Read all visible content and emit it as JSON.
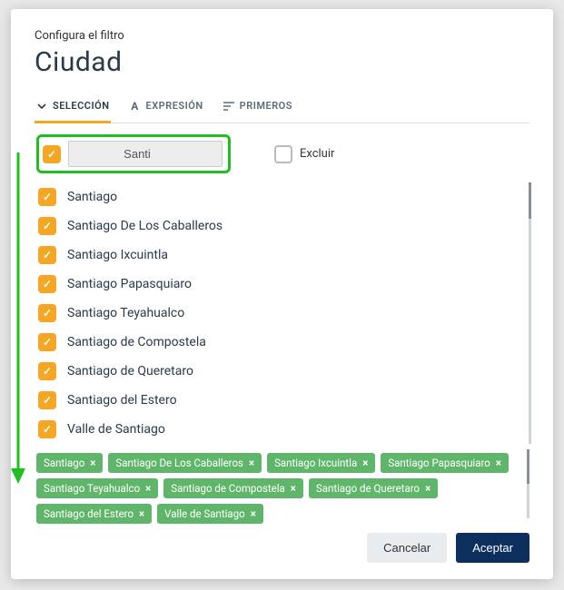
{
  "header": {
    "subtitle": "Configura el filtro",
    "title": "Ciudad"
  },
  "tabs": {
    "selection": "SELECCIÓN",
    "expression": "EXPRESIÓN",
    "first": "PRIMEROS"
  },
  "search": {
    "value": "Santi",
    "exclude_label": "Excluir"
  },
  "items": [
    "Santiago",
    "Santiago De Los Caballeros",
    "Santiago Ixcuintla",
    "Santiago Papasquiaro",
    "Santiago Teyahualco",
    "Santiago de Compostela",
    "Santiago de Queretaro",
    "Santiago del Estero",
    "Valle de Santiago"
  ],
  "chips": [
    "Santiago",
    "Santiago De Los Caballeros",
    "Santiago Ixcuintla",
    "Santiago Papasquiaro",
    "Santiago Teyahualco",
    "Santiago de Compostela",
    "Santiago de Queretaro",
    "Santiago del Estero",
    "Valle de Santiago"
  ],
  "footer": {
    "cancel": "Cancelar",
    "accept": "Aceptar"
  },
  "colors": {
    "accent": "#f5a623",
    "highlight": "#1fbf1f",
    "chip": "#5fb66a",
    "primary": "#0d2f5e"
  }
}
